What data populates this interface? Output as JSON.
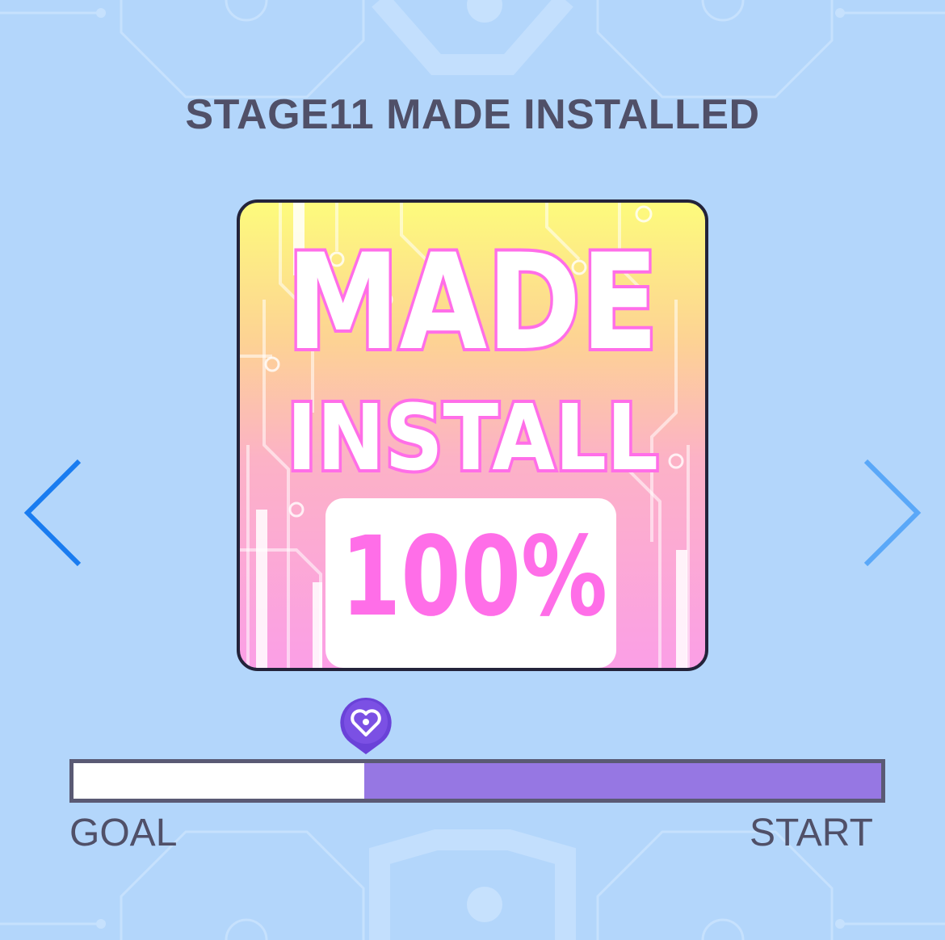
{
  "stage": {
    "title": "STAGE11 MADE INSTALLED"
  },
  "card": {
    "line1": "MADE",
    "line2": "INSTALL",
    "percent": "100%"
  },
  "navigation": {
    "prev_icon": "chevron-left-icon",
    "next_icon": "chevron-right-icon"
  },
  "progress": {
    "marker_icon": "heart-pin-icon",
    "fraction_remaining": 0.64,
    "goal_label": "GOAL",
    "start_label": "START"
  },
  "colors": {
    "background": "#b3d6fb",
    "title_text": "#505068",
    "progress_fill": "#9677e3",
    "accent_pink": "#ff6ee8",
    "arrow_prev": "#1a7cf0",
    "arrow_next": "#5aa8f8"
  }
}
